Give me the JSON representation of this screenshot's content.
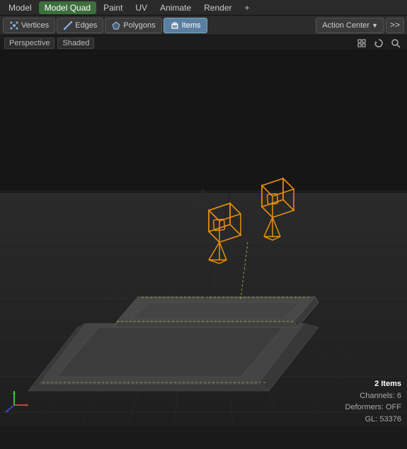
{
  "menu": {
    "items": [
      {
        "label": "Model",
        "active": false
      },
      {
        "label": "Model Quad",
        "active": true
      },
      {
        "label": "Paint",
        "active": false
      },
      {
        "label": "UV",
        "active": false
      },
      {
        "label": "Animate",
        "active": false
      },
      {
        "label": "Render",
        "active": false
      },
      {
        "label": "+",
        "active": false
      }
    ]
  },
  "toolbar": {
    "vertices_label": "Vertices",
    "edges_label": "Edges",
    "polygons_label": "Polygons",
    "items_label": "Items",
    "action_center_label": "Action Center",
    "chevron_label": ">>"
  },
  "viewport": {
    "perspective_label": "Perspective",
    "shaded_label": "Shaded"
  },
  "status": {
    "items": "2 Items",
    "channels": "Channels: 6",
    "deformers": "Deformers: OFF",
    "gl": "GL: 53376"
  }
}
